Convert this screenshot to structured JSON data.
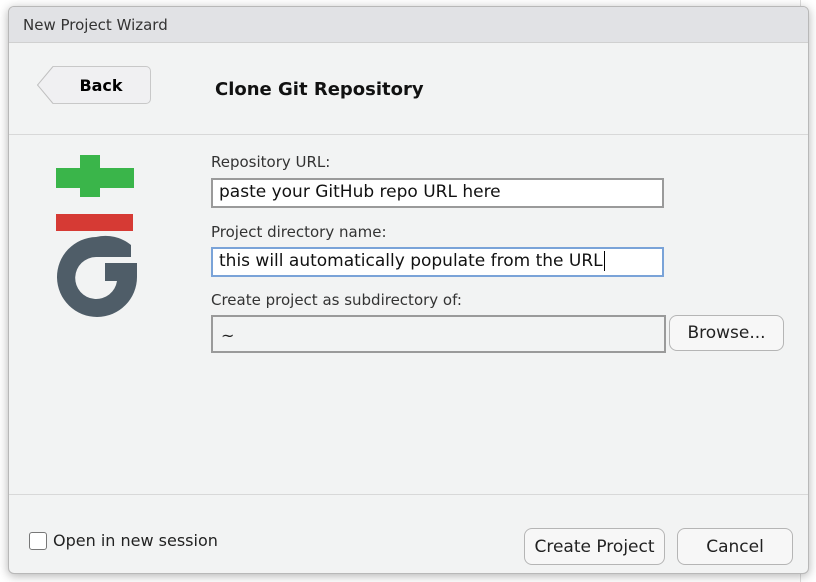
{
  "window": {
    "title": "New Project Wizard"
  },
  "header": {
    "back_label": "Back",
    "title": "Clone Git Repository"
  },
  "form": {
    "repo_url_label": "Repository URL:",
    "repo_url_value": "paste your GitHub repo URL here",
    "dir_name_label": "Project directory name:",
    "dir_name_value": "this will automatically populate from the URL",
    "subdir_label": "Create project as subdirectory of:",
    "subdir_value": "~",
    "browse_label": "Browse..."
  },
  "footer": {
    "open_new_session_label": "Open in new session",
    "open_new_session_checked": false,
    "create_label": "Create Project",
    "cancel_label": "Cancel"
  },
  "logo": {
    "icon": "git-icon",
    "colors": {
      "plus": "#3ab54a",
      "bar": "#d63a34",
      "g": "#4f5d68"
    }
  }
}
